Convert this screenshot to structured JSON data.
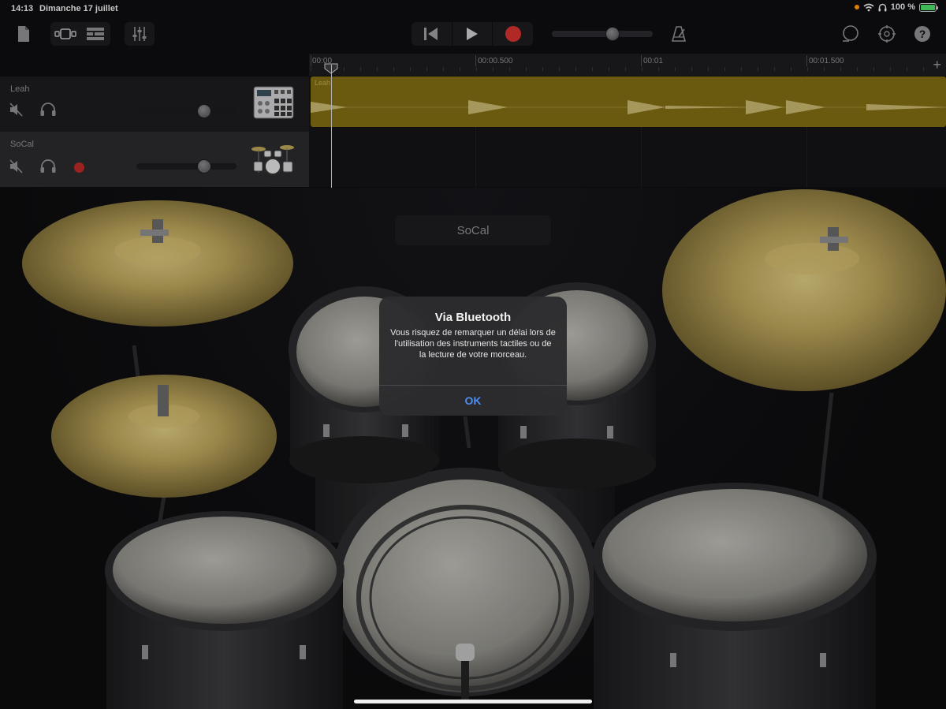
{
  "status_bar": {
    "time": "14:13",
    "date": "Dimanche 17 juillet",
    "battery": "100 %",
    "icons": [
      "orange-dot-icon",
      "wifi-icon",
      "headphones-icon",
      "battery-charging-icon"
    ]
  },
  "toolbar": {
    "left_icons": [
      "my-songs-icon",
      "browser-view-icon",
      "tracks-view-icon",
      "mixer-icon"
    ],
    "transport": [
      "go-to-beginning-icon",
      "play-icon",
      "record-icon"
    ],
    "right_icons": [
      "metronome-icon",
      "loop-icon",
      "settings-icon",
      "help-icon"
    ],
    "master_volume": 0.6
  },
  "ruler": {
    "labels": [
      "00:00",
      "00:00.500",
      "00:01",
      "00:01.500"
    ],
    "add_label": "+"
  },
  "tracks": [
    {
      "name": "Leah",
      "instrument_icon": "beat-sequencer-icon",
      "volume": 0.68,
      "region_label": "Leah"
    },
    {
      "name": "SoCal",
      "instrument_icon": "drum-kit-icon",
      "volume": 0.68,
      "record_armed": true
    }
  ],
  "instrument": {
    "name": "SoCal"
  },
  "alert": {
    "title": "Via Bluetooth",
    "message": "Vous risquez de remarquer un délai lors de l'utilisation des instruments tactiles ou de la lecture de votre morceau.",
    "ok_label": "OK"
  },
  "colors": {
    "region": "#7d6a12",
    "record": "#d0312d",
    "accent": "#4d8cf5",
    "cymbal": "#b8a155"
  }
}
